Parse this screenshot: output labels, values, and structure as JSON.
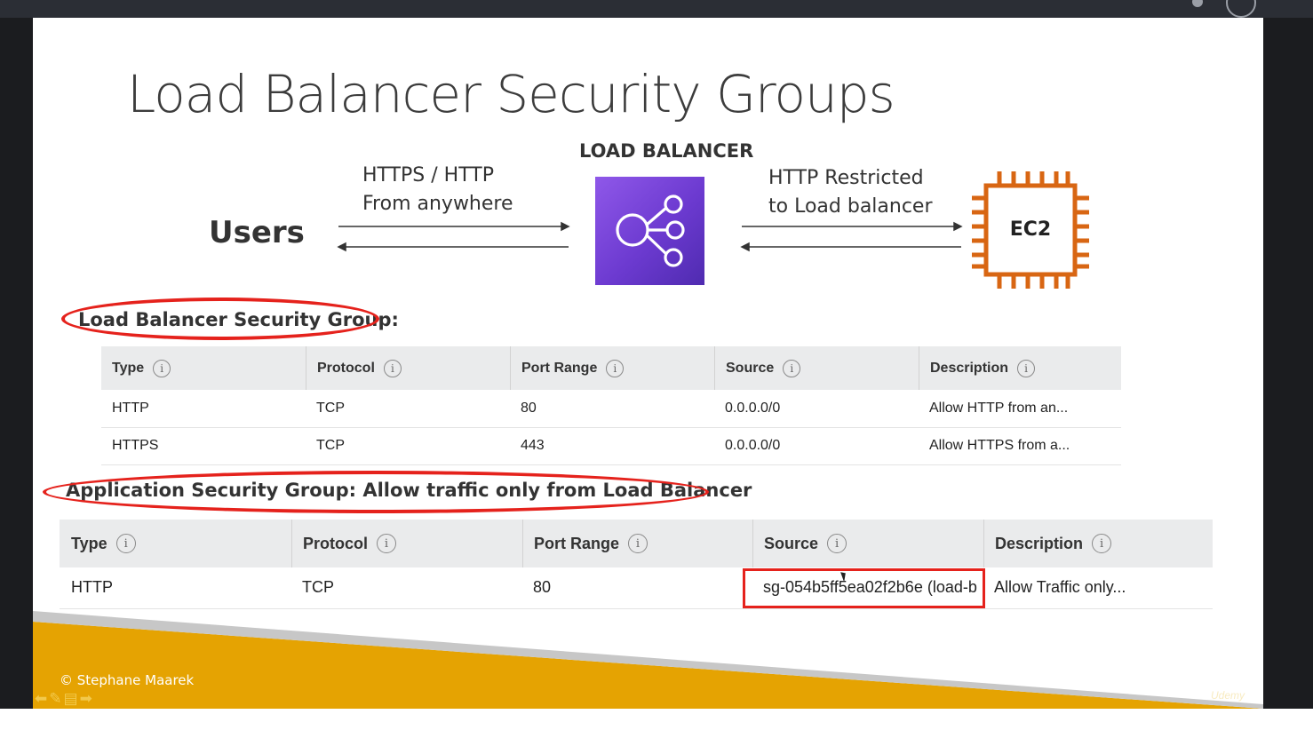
{
  "slide": {
    "title": "Load Balancer Security Groups",
    "load_balancer_label": "LOAD BALANCER",
    "users_label": "Users",
    "ec2_label": "EC2",
    "incoming_caption_line1": "HTTPS / HTTP",
    "incoming_caption_line2": "From anywhere",
    "backend_caption_line1": "HTTP Restricted",
    "backend_caption_line2": "to Load balancer",
    "copyright": "© Stephane Maarek",
    "watermark": "Udemy"
  },
  "lb_security_group": {
    "heading": "Load Balancer Security Group:",
    "columns": [
      "Type",
      "Protocol",
      "Port Range",
      "Source",
      "Description"
    ],
    "rows": [
      [
        "HTTP",
        "TCP",
        "80",
        "0.0.0.0/0",
        "Allow HTTP from an..."
      ],
      [
        "HTTPS",
        "TCP",
        "443",
        "0.0.0.0/0",
        "Allow HTTPS from a..."
      ]
    ]
  },
  "app_security_group": {
    "heading": "Application Security Group: Allow traffic only from Load Balancer",
    "columns": [
      "Type",
      "Protocol",
      "Port Range",
      "Source",
      "Description"
    ],
    "rows": [
      [
        "HTTP",
        "TCP",
        "80",
        "sg-054b5ff5ea02f2b6e (load-b",
        "Allow Traffic only..."
      ]
    ]
  },
  "icons": {
    "load_balancer": "elb-icon",
    "ec2": "ec2-chip-icon",
    "info": "info-icon",
    "nav": [
      "arrow-left-icon",
      "pen-icon",
      "notes-icon",
      "arrow-right-icon"
    ]
  },
  "colors": {
    "highlight": "#e5221c",
    "lb_purple": "#7b47dc",
    "ec2_orange": "#d86613",
    "footer_gold": "#e5a302"
  },
  "info_glyph": "i"
}
